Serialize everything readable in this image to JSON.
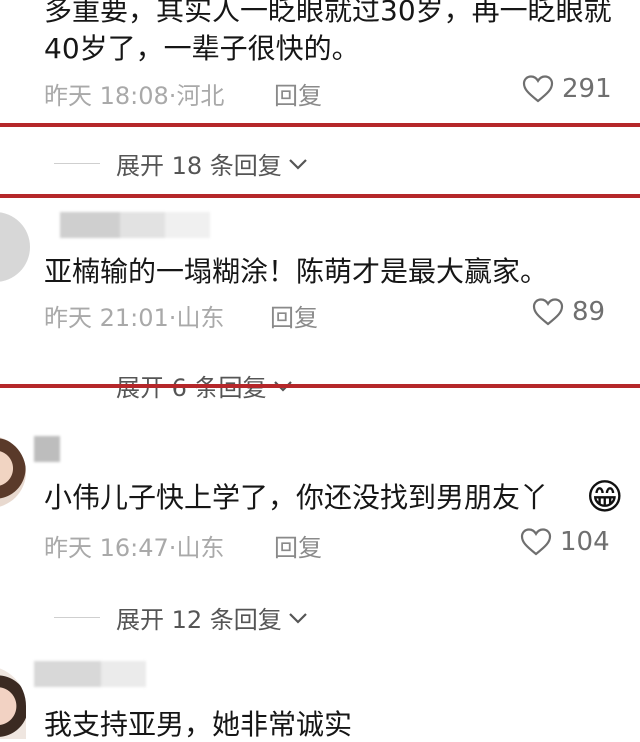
{
  "comments": [
    {
      "text_lines": [
        "多重要，其实人一眨眼就过30岁，再一眨眼就",
        "40岁了，一辈子很快的。"
      ],
      "time": "昨天 18:08",
      "location": "河北",
      "reply": "回复",
      "likes": "291",
      "expand": "展开 18 条回复"
    },
    {
      "text": "亚楠输的一塌糊涂！陈萌才是最大赢家。",
      "time": "昨天 21:01",
      "location": "山东",
      "reply": "回复",
      "likes": "89",
      "expand": "展开 6 条回复"
    },
    {
      "text": "小伟儿子快上学了，你还没找到男朋友丫",
      "emoji": "😁",
      "time": "昨天 16:47",
      "location": "山东",
      "reply": "回复",
      "likes": "104",
      "expand": "展开 12 条回复"
    },
    {
      "text": "我支持亚男，她非常诚实"
    }
  ],
  "colors": {
    "highlight_red": "#b5272a",
    "meta_gray": "#a9a9a9",
    "text": "#161616"
  },
  "icons": {
    "like": "heart-outline-icon",
    "expand": "chevron-down-icon"
  }
}
